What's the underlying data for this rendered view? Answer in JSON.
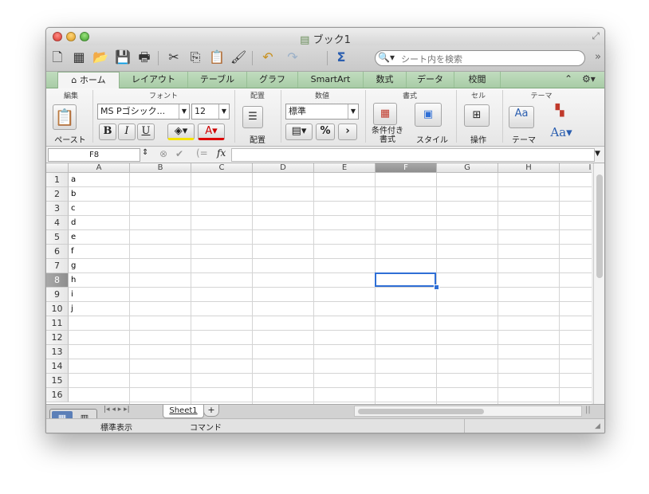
{
  "window": {
    "title": "ブック1"
  },
  "toolbar": {
    "search_placeholder": "シート内を検索",
    "more": "»"
  },
  "ribbon_tabs": {
    "home": "ホーム",
    "layout": "レイアウト",
    "table": "テーブル",
    "chart": "グラフ",
    "smartart": "SmartArt",
    "formulas": "数式",
    "data": "データ",
    "review": "校閲"
  },
  "ribbon": {
    "groups": {
      "edit": "編集",
      "font": "フォント",
      "align": "配置",
      "number": "数値",
      "format": "書式",
      "cells": "セル",
      "themes": "テーマ"
    },
    "paste_label": "ペースト",
    "font_name": "MS Pゴシック...",
    "font_size": "12",
    "bold": "B",
    "italic": "I",
    "underline": "U",
    "align_label": "配置",
    "number_format": "標準",
    "percent": "%",
    "cond_format_line1": "条件付き",
    "cond_format_line2": "書式",
    "style_label": "スタイル",
    "cells_label": "操作",
    "theme_label": "テーマ",
    "theme_font": "Aa"
  },
  "formula_bar": {
    "name_box": "F8",
    "fx": "fx"
  },
  "sheet": {
    "columns": [
      "A",
      "B",
      "C",
      "D",
      "E",
      "F",
      "G",
      "H",
      "I"
    ],
    "rows": [
      "1",
      "2",
      "3",
      "4",
      "5",
      "6",
      "7",
      "8",
      "9",
      "10",
      "11",
      "12",
      "13",
      "14",
      "15",
      "16"
    ],
    "column_a_values": [
      "a",
      "b",
      "c",
      "d",
      "e",
      "f",
      "g",
      "h",
      "i",
      "j"
    ],
    "selected_cell": "F8"
  },
  "sheet_tabs": {
    "active": "Sheet1",
    "add": "+"
  },
  "status": {
    "view": "標準表示",
    "mode": "コマンド"
  },
  "colors": {
    "ribbon_tab_green": "#a8cca6",
    "selection_blue": "#2f6fd6"
  }
}
